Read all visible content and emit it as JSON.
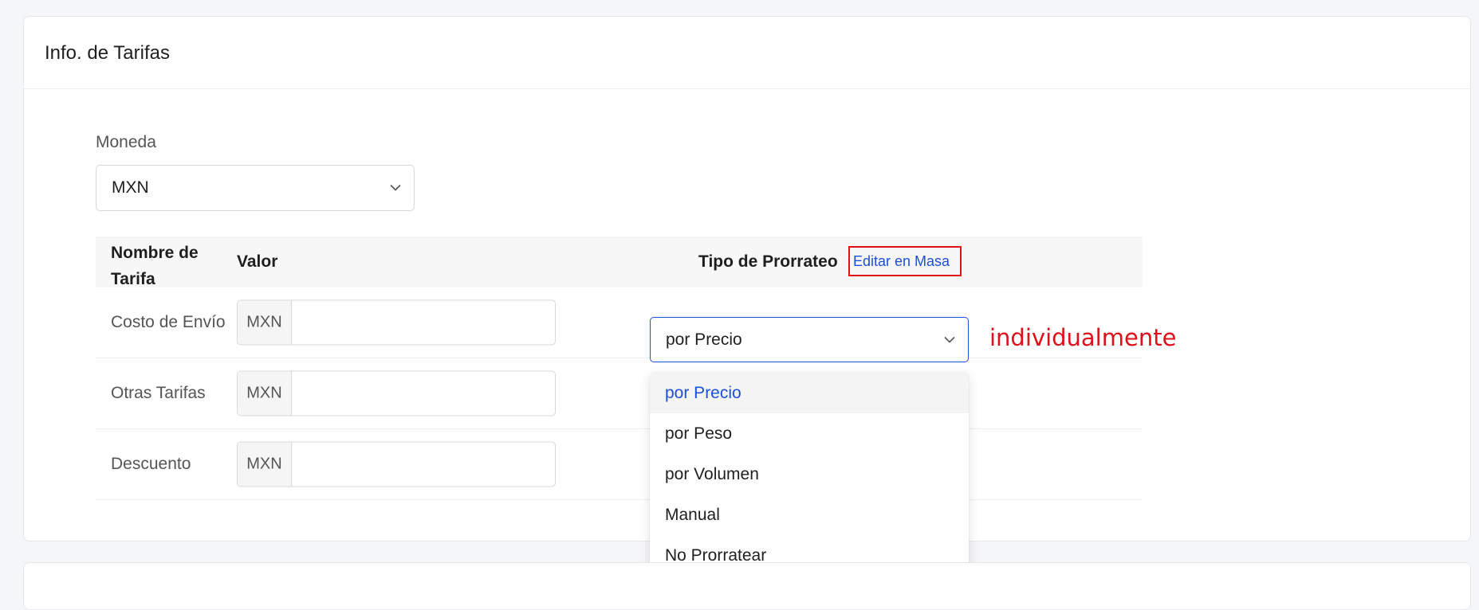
{
  "card": {
    "title": "Info. de Tarifas"
  },
  "moneda": {
    "label": "Moneda",
    "selected": "MXN"
  },
  "table": {
    "headers": {
      "nombre": "Nombre de Tarifa",
      "valor": "Valor",
      "tipo": "Tipo de Prorrateo",
      "bulk_edit_link": "Editar en Masa"
    },
    "rows": [
      {
        "name": "Costo de Envío",
        "currency": "MXN",
        "value": ""
      },
      {
        "name": "Otras Tarifas",
        "currency": "MXN",
        "value": ""
      },
      {
        "name": "Descuento",
        "currency": "MXN",
        "value": ""
      }
    ]
  },
  "prorrateo_select": {
    "selected": "por Precio",
    "options": [
      "por Precio",
      "por Peso",
      "por Volumen",
      "Manual",
      "No Prorratear"
    ]
  },
  "annotation": {
    "text": "individualmente",
    "color": "#e0101a"
  },
  "colors": {
    "accent": "#1d4fd8",
    "annotation_red": "#e0101a"
  }
}
